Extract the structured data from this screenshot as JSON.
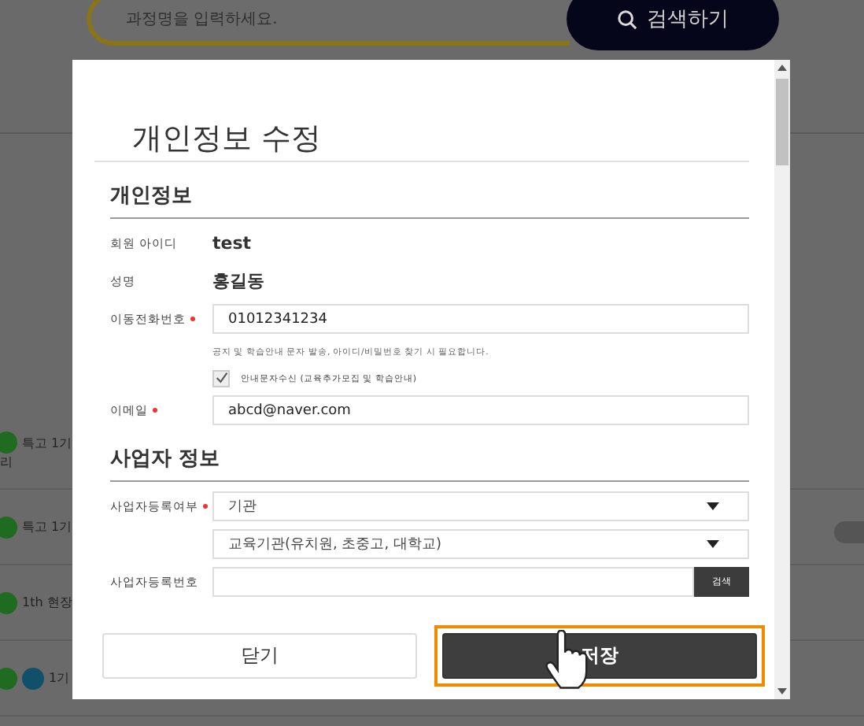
{
  "search": {
    "placeholder": "과정명을 입력하세요.",
    "button": "검색하기"
  },
  "background_rows": [
    {
      "lines": [
        "특고 1기",
        "리"
      ],
      "kind": "green"
    },
    {
      "lines": [
        "특고 1기"
      ],
      "kind": "green"
    },
    {
      "lines": [
        "1th 현장"
      ],
      "kind": "green"
    },
    {
      "lines": [
        "1기"
      ],
      "kind": "green_blue"
    }
  ],
  "modal": {
    "title": "개인정보 수정",
    "sections": [
      {
        "title": "개인정보",
        "fields": [
          {
            "kind": "text",
            "label": "회원 아이디",
            "required": false,
            "value": "test"
          },
          {
            "kind": "text",
            "label": "성명",
            "required": false,
            "value": "홍길동"
          },
          {
            "kind": "input",
            "label": "이동전화번호",
            "required": true,
            "value": "01012341234"
          },
          {
            "kind": "hint",
            "text": "공지 및 학습안내 문자 발송, 아이디/비밀번호 찾기 시 필요합니다."
          },
          {
            "kind": "checkbox",
            "text": "안내문자수신 (교육추가모집 및 학습안내)",
            "checked": true
          },
          {
            "kind": "input",
            "label": "이메일",
            "required": true,
            "value": "abcd@naver.com"
          }
        ]
      },
      {
        "title": "사업자 정보",
        "fields": [
          {
            "kind": "select",
            "label": "사업자등록여부",
            "required": true,
            "value": "기관"
          },
          {
            "kind": "select",
            "required": false,
            "value": "교육기관(유치원, 초중고, 대학교)"
          },
          {
            "kind": "input_button",
            "label": "사업자등록번호",
            "required": false,
            "button": "검색"
          }
        ]
      }
    ],
    "buttons": [
      {
        "label": "닫기",
        "primary": false,
        "focused": false
      },
      {
        "label": "저장",
        "primary": true,
        "focused": true
      }
    ]
  }
}
